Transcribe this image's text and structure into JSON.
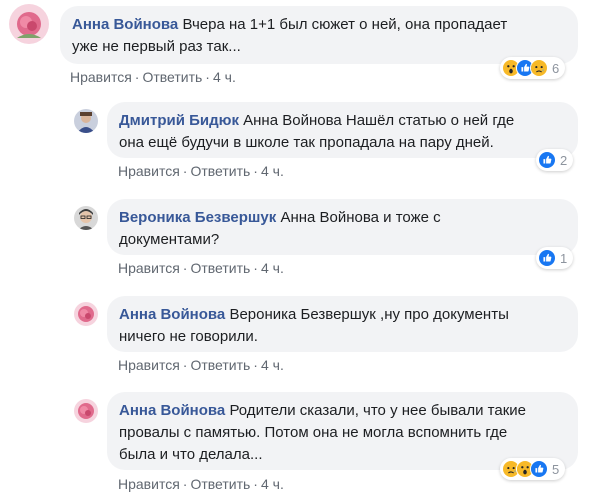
{
  "comments": [
    {
      "author": "Анна Войнова",
      "text_lines": [
        "Вчера на 1+1 был сюжет о ней, она пропадает",
        "уже не первый раз так..."
      ],
      "actions": {
        "like": "Нравится",
        "reply": "Ответить",
        "time": "4 ч."
      },
      "reactions": {
        "icons": [
          "wow-icon",
          "like-icon",
          "sad-icon"
        ],
        "count": "6"
      }
    },
    {
      "author": "Дмитрий Бидюк",
      "text_lines": [
        "Анна Войнова Нашёл статью о ней где",
        "она ещё будучи в школе так пропадала на пару дней."
      ],
      "actions": {
        "like": "Нравится",
        "reply": "Ответить",
        "time": "4 ч."
      },
      "reactions": {
        "icons": [
          "like-icon"
        ],
        "count": "2"
      }
    },
    {
      "author": "Вероника Безвершук",
      "text_lines": [
        "Анна Войнова и тоже с",
        "документами?"
      ],
      "actions": {
        "like": "Нравится",
        "reply": "Ответить",
        "time": "4 ч."
      },
      "reactions": {
        "icons": [
          "like-icon"
        ],
        "count": "1"
      }
    },
    {
      "author": "Анна Войнова",
      "text_lines": [
        "Вероника Безвершук ,ну про документы",
        "ничего не говорили."
      ],
      "actions": {
        "like": "Нравится",
        "reply": "Ответить",
        "time": "4 ч."
      }
    },
    {
      "author": "Анна Войнова",
      "text_lines": [
        "Родители сказали, что у нее бывали такие",
        "провалы с памятью. Потом она не могла вспомнить где",
        "была и что делала..."
      ],
      "actions": {
        "like": "Нравится",
        "reply": "Ответить",
        "time": "4 ч."
      },
      "reactions": {
        "icons": [
          "sad-icon",
          "wow-icon",
          "like-icon"
        ],
        "count": "5"
      }
    }
  ],
  "colors": {
    "author": "#385898",
    "bubble_bg": "#f2f3f5",
    "meta": "#606770",
    "like_blue": "#1877f2",
    "emoji_yellow": "#f7b928"
  }
}
